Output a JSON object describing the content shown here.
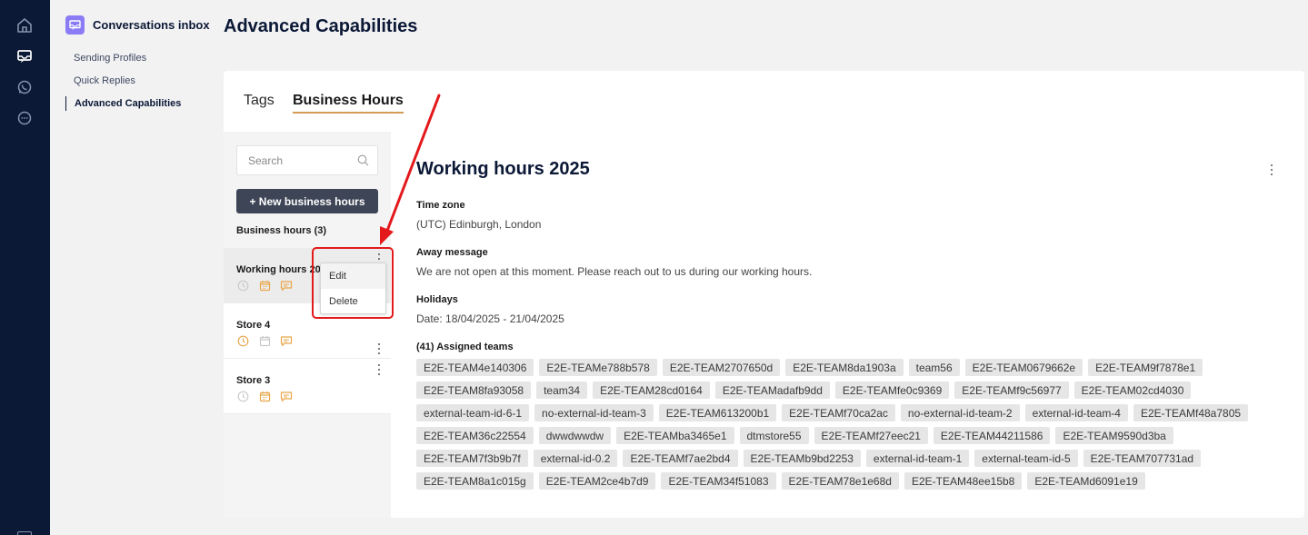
{
  "app": {
    "title": "Conversations inbox",
    "accent": "#8b7cf6",
    "rail_icons": [
      "home-icon",
      "inbox-icon",
      "whatsapp-icon",
      "chat-bubble-icon"
    ]
  },
  "subnav": {
    "items": [
      {
        "label": "Sending Profiles",
        "active": false
      },
      {
        "label": "Quick Replies",
        "active": false
      },
      {
        "label": "Advanced Capabilities",
        "active": true
      }
    ]
  },
  "page": {
    "title": "Advanced Capabilities"
  },
  "tabs": [
    {
      "label": "Tags",
      "active": false
    },
    {
      "label": "Business Hours",
      "active": true
    }
  ],
  "left": {
    "search_placeholder": "Search",
    "new_button": "+ New business hours",
    "count_label": "Business hours (3)",
    "items": [
      {
        "name": "Working hours 2025",
        "icons": [
          "clock-icon",
          "calendar-icon",
          "message-icon"
        ],
        "active_icons": [
          "calendar-icon",
          "message-icon"
        ]
      },
      {
        "name": "Store 4",
        "icons": [
          "clock-icon",
          "calendar-icon",
          "message-icon"
        ],
        "active_icons": [
          "clock-icon",
          "message-icon"
        ]
      },
      {
        "name": "Store 3",
        "icons": [
          "clock-icon",
          "calendar-icon",
          "message-icon"
        ],
        "active_icons": [
          "calendar-icon",
          "message-icon"
        ]
      }
    ],
    "context_menu": [
      "Edit",
      "Delete"
    ]
  },
  "detail": {
    "title": "Working hours 2025",
    "timezone_label": "Time zone",
    "timezone_value": "(UTC) Edinburgh, London",
    "away_label": "Away message",
    "away_value": "We are not open at this moment. Please reach out to us during our working hours.",
    "holidays_label": "Holidays",
    "holidays_value": "Date: 18/04/2025 - 21/04/2025",
    "teams_label": "(41) Assigned teams",
    "teams": [
      "E2E-TEAM4e140306",
      "E2E-TEAMe788b578",
      "E2E-TEAM2707650d",
      "E2E-TEAM8da1903a",
      "team56",
      "E2E-TEAM0679662e",
      "E2E-TEAM9f7878e1",
      "E2E-TEAM8fa93058",
      "team34",
      "E2E-TEAM28cd0164",
      "E2E-TEAMadafb9dd",
      "E2E-TEAMfe0c9369",
      "E2E-TEAMf9c56977",
      "E2E-TEAM02cd4030",
      "external-team-id-6-1",
      "no-external-id-team-3",
      "E2E-TEAM613200b1",
      "E2E-TEAMf70ca2ac",
      "no-external-id-team-2",
      "external-id-team-4",
      "E2E-TEAMf48a7805",
      "E2E-TEAM36c22554",
      "dwwdwwdw",
      "E2E-TEAMba3465e1",
      "dtmstore55",
      "E2E-TEAMf27eec21",
      "E2E-TEAM44211586",
      "E2E-TEAM9590d3ba",
      "E2E-TEAM7f3b9b7f",
      "external-id-0.2",
      "E2E-TEAMf7ae2bd4",
      "E2E-TEAMb9bd2253",
      "external-id-team-1",
      "external-team-id-5",
      "E2E-TEAM707731ad",
      "E2E-TEAM8a1c015g",
      "E2E-TEAM2ce4b7d9",
      "E2E-TEAM34f51083",
      "E2E-TEAM78e1e68d",
      "E2E-TEAM48ee15b8",
      "E2E-TEAMd6091e19"
    ]
  },
  "colors": {
    "rail": "#0b1836",
    "tab_underline": "#d49b55",
    "icon_active": "#e8a64a",
    "icon_inactive": "#c9c9c9",
    "annotation": "#e3191c"
  }
}
